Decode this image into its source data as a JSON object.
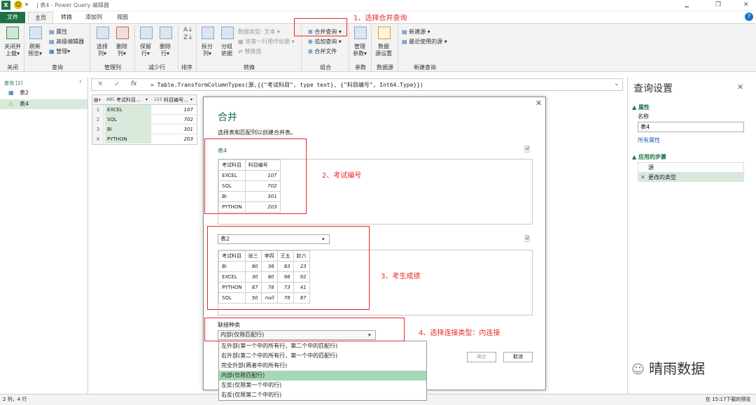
{
  "titlebar": {
    "title": "| 表4 - Power Query 编辑器",
    "app_icon": "X",
    "min": "🗕",
    "max": "❐",
    "close": "✕"
  },
  "tabs": [
    "文件",
    "主页",
    "转换",
    "添加列",
    "视图"
  ],
  "help": "?",
  "ribbon": {
    "close_load": [
      "关闭并",
      "上载▾"
    ],
    "refresh": [
      "刷新",
      "预览▾"
    ],
    "properties": "属性",
    "adv_editor": "高级编辑器",
    "manage": "管理▾",
    "choose_cols": [
      "选择",
      "列▾"
    ],
    "remove_cols": [
      "删除",
      "列▾"
    ],
    "keep_rows": [
      "保留",
      "行▾"
    ],
    "remove_rows": [
      "删除",
      "行▾"
    ],
    "split": [
      "拆分",
      "列▾"
    ],
    "group": [
      "分组",
      "依据"
    ],
    "datatype": "数据类型: 文本 ▾",
    "first_row": "将第一行用作标题 ▾",
    "replace": "替换值",
    "merge": "合并查询 ▾",
    "append": "追加查询 ▾",
    "combine_files": "合并文件",
    "manage_params": [
      "管理",
      "参数▾"
    ],
    "ds_settings": [
      "数据",
      "源设置"
    ],
    "new_source": "新建源 ▾",
    "recent": "最近使用的源 ▾",
    "groups": [
      "关闭",
      "查询",
      "管理列",
      "减少行",
      "排序",
      "转换",
      "组合",
      "参数",
      "数据源",
      "新建查询"
    ]
  },
  "annotations": {
    "a1": "1、选择合并查询",
    "a2": "2、考试编号",
    "a3": "3、考生成绩",
    "a4": "4、选择连接类型：内连接"
  },
  "left": {
    "header": "查询 [2]",
    "items": [
      "表2",
      "表4"
    ]
  },
  "formula": "= Table.TransformColumnTypes(源,{{\"考试科目\", type text}, {\"科目编号\", Int64.Type}})",
  "grid": {
    "headers": [
      "考试科目...",
      "科目编号..."
    ],
    "header_types": [
      "ABC",
      "123"
    ],
    "rows": [
      [
        "1",
        "EXCEL",
        "107"
      ],
      [
        "2",
        "SQL",
        "702"
      ],
      [
        "3",
        "BI",
        "301"
      ],
      [
        "4",
        "PYTHON",
        "203"
      ]
    ]
  },
  "right": {
    "title": "查询设置",
    "props": "▲ 属性",
    "name_label": "名称",
    "name_value": "表4",
    "all_props": "所有属性",
    "steps_label": "▲ 应用的步骤",
    "steps": [
      "源",
      "更改的类型"
    ]
  },
  "dialog": {
    "title": "合并",
    "subtitle": "选择表和匹配列以创建合并表。",
    "t1_name": "表4",
    "t1_headers": [
      "考试科目",
      "科目编号"
    ],
    "t1_rows": [
      [
        "EXCEL",
        "107"
      ],
      [
        "SQL",
        "702"
      ],
      [
        "BI",
        "301"
      ],
      [
        "PYTHON",
        "203"
      ]
    ],
    "t2_select": "表2",
    "t2_headers": [
      "考试科目",
      "张三",
      "李四",
      "王五",
      "赵六"
    ],
    "t2_rows": [
      [
        "BI",
        "80",
        "38",
        "83",
        "23"
      ],
      [
        "EXCEL",
        "30",
        "80",
        "98",
        "92"
      ],
      [
        "PYTHON",
        "87",
        "78",
        "73",
        "41"
      ],
      [
        "SQL",
        "50",
        "null",
        "78",
        "87"
      ]
    ],
    "join_label": "联接种类",
    "join_value": "内部(仅限匹配行)",
    "join_options": [
      "左外部(第一个中的所有行，第二个中的匹配行)",
      "右外部(第二个中的所有行，第一个中的匹配行)",
      "完全外部(两者中的所有行)",
      "内部(仅限匹配行)",
      "左反(仅限第一个中的行)",
      "右反(仅限第二个中的行)"
    ],
    "ok": "确定",
    "cancel": "取消"
  },
  "status": {
    "left": "2 列，4 行",
    "right": "在 15:17下载的预览"
  },
  "watermark": "晴雨数据"
}
